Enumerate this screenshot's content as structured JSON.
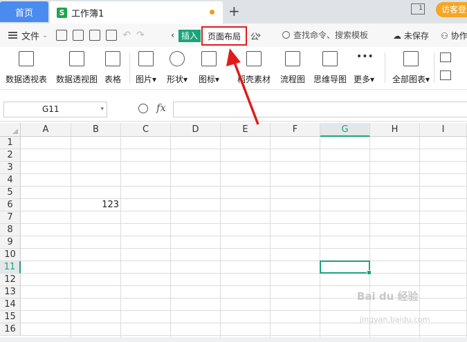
{
  "tabs": {
    "home": "首页",
    "document": "工作簿1",
    "document_icon": "S",
    "guest_login": "访客登录"
  },
  "menu": {
    "file": "文件",
    "insert_tab": "插入",
    "page_layout_tab": "页面布局",
    "search_placeholder": "查找命令、搜索模板",
    "unsaved": "未保存",
    "collaborate": "协作"
  },
  "toolbar": {
    "items": [
      {
        "label": "数据透视表"
      },
      {
        "label": "数据透视图"
      },
      {
        "label": "表格"
      },
      {
        "label": "图片▾"
      },
      {
        "label": "形状▾"
      },
      {
        "label": "图标▾"
      },
      {
        "label": "稻壳素材"
      },
      {
        "label": "流程图"
      },
      {
        "label": "思维导图"
      },
      {
        "label": "更多▾"
      },
      {
        "label": "全部图表▾"
      }
    ]
  },
  "formula": {
    "cell_name": "G11",
    "fx": "fx"
  },
  "sheet": {
    "columns": [
      "A",
      "B",
      "C",
      "D",
      "E",
      "F",
      "G",
      "H",
      "I"
    ],
    "rows": [
      "1",
      "2",
      "3",
      "4",
      "5",
      "6",
      "7",
      "8",
      "9",
      "10",
      "11",
      "12",
      "13",
      "14",
      "15",
      "16"
    ],
    "selected_column": "G",
    "selected_row": "11",
    "cells": [
      {
        "ref": "B6",
        "value": "123"
      }
    ]
  },
  "watermark": {
    "brand": "Bai du 经验",
    "url": "jingyan.baidu.com"
  },
  "colors": {
    "accent": "#1ba37a",
    "home_tab": "#4a8bef",
    "highlight": "#e01b1b"
  }
}
